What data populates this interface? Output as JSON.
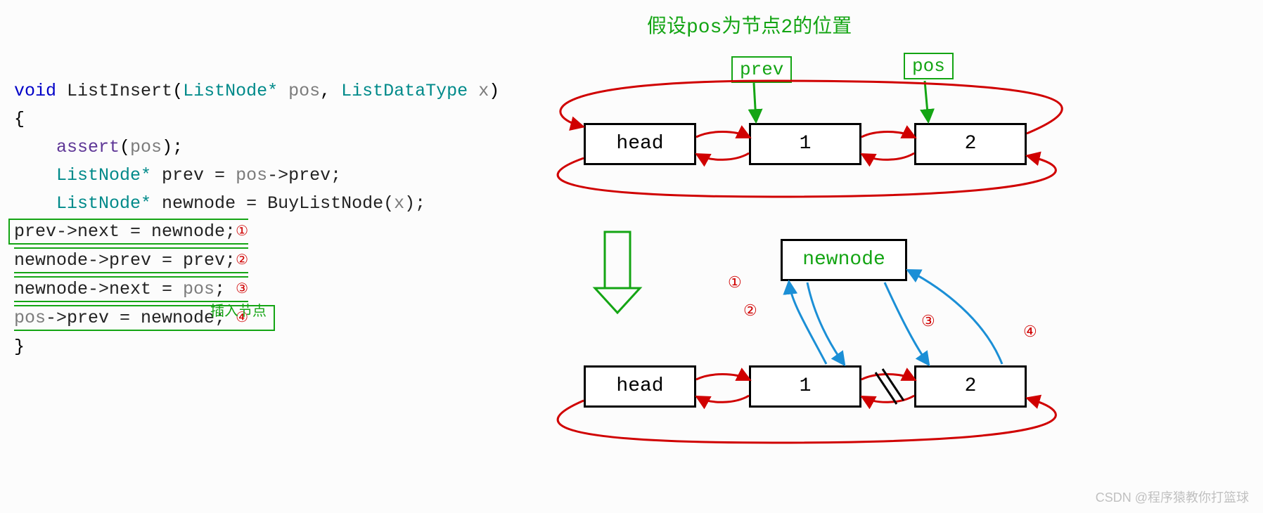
{
  "code": {
    "ret": "void",
    "fn": "ListInsert",
    "p1type": "ListNode*",
    "p1name": "pos",
    "p2type": "ListDataType",
    "p2name": "x",
    "assert": "assert",
    "posvar": "pos",
    "line_prev_decl_t": "ListNode*",
    "line_prev_decl": " prev = ",
    "line_prev_rhs_a": "pos",
    "line_prev_rhs_b": "->prev;",
    "line_new_t": "ListNode*",
    "line_new_a": " newnode = BuyListNode(",
    "line_new_p": "x",
    "line_new_b": ");",
    "s1": "prev->next = newnode;",
    "s2": "newnode->prev = prev;",
    "s3a": "newnode->next = ",
    "s3b": "pos",
    "s3c": ";",
    "s4a": "pos",
    "s4b": "->prev = newnode;",
    "c1": "①",
    "c2": "②",
    "c3": "③",
    "c4": "④",
    "insert_note": "插入节点"
  },
  "diag": {
    "title": "假设pos为节点2的位置",
    "prev": "prev",
    "pos": "pos",
    "head": "head",
    "n1": "1",
    "n2": "2",
    "newnode": "newnode",
    "m1": "①",
    "m2": "②",
    "m3": "③",
    "m4": "④"
  },
  "watermark": "CSDN @程序猿教你打篮球"
}
